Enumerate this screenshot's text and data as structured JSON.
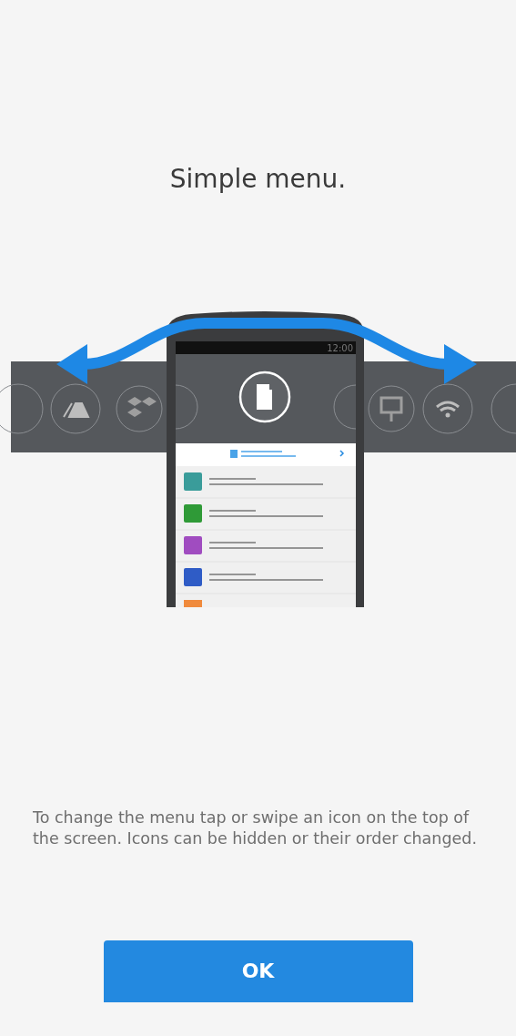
{
  "title": "Simple menu.",
  "illustration": {
    "status_time": "12:00",
    "menu_rows": [
      {
        "color": "#3a9c9a"
      },
      {
        "color": "#2f9a37"
      },
      {
        "color": "#a04cc0"
      },
      {
        "color": "#2f5cc6"
      },
      {
        "color": "#f08a3c"
      }
    ]
  },
  "description": "To change the menu tap or swipe an icon on the top of the screen. Icons can be hidden or their order changed.",
  "ok_button": "OK"
}
